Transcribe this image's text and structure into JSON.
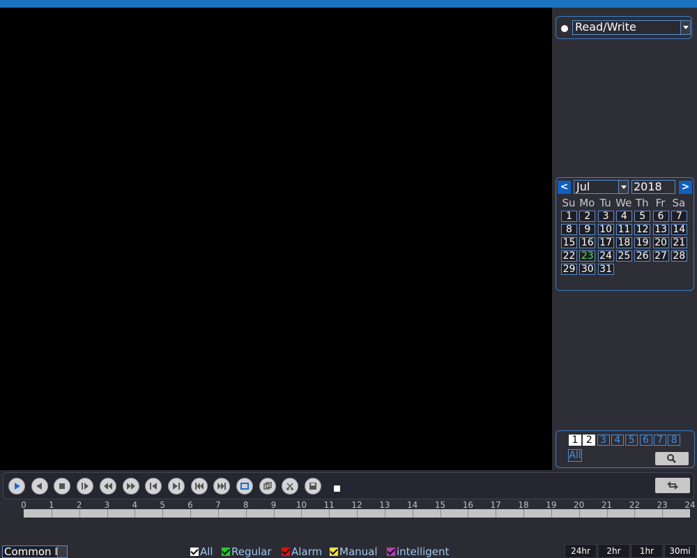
{
  "mode": {
    "selected": "Read/Write"
  },
  "calendar": {
    "month": "Jul",
    "year": "2018",
    "prev_label": "<",
    "next_label": ">",
    "weekdays": [
      "Su",
      "Mo",
      "Tu",
      "We",
      "Th",
      "Fr",
      "Sa"
    ],
    "days": [
      [
        "1",
        "2",
        "3",
        "4",
        "5",
        "6",
        "7"
      ],
      [
        "8",
        "9",
        "10",
        "11",
        "12",
        "13",
        "14"
      ],
      [
        "15",
        "16",
        "17",
        "18",
        "19",
        "20",
        "21"
      ],
      [
        "22",
        "23",
        "24",
        "25",
        "26",
        "27",
        "28"
      ],
      [
        "29",
        "30",
        "31"
      ]
    ],
    "highlighted_day": "23",
    "highlight_color": "#55e055"
  },
  "channels": {
    "items": [
      "1",
      "2",
      "3",
      "4",
      "5",
      "6",
      "7",
      "8"
    ],
    "selected": [
      "1",
      "2"
    ],
    "all_label": "All"
  },
  "controls": {
    "buttons": [
      "play-icon",
      "reverse-play-icon",
      "stop-icon",
      "slow-play-icon",
      "fast-backward-icon",
      "fast-forward-icon",
      "previous-frame-icon",
      "next-frame-icon",
      "previous-file-icon",
      "next-file-icon",
      "loop-icon",
      "fullscreen-icon",
      "clip-icon",
      "save-icon"
    ],
    "sync_icon": "sync-icon",
    "search_icon": "search-icon"
  },
  "timeline": {
    "labels": [
      "0",
      "1",
      "2",
      "3",
      "4",
      "5",
      "6",
      "7",
      "8",
      "9",
      "10",
      "11",
      "12",
      "13",
      "14",
      "15",
      "16",
      "17",
      "18",
      "19",
      "20",
      "21",
      "22",
      "23",
      "24"
    ]
  },
  "bottom": {
    "common_select": "Common I",
    "filters": [
      {
        "label": "All",
        "color": "#ffffff"
      },
      {
        "label": "Regular",
        "color": "#22cc22"
      },
      {
        "label": "Alarm",
        "color": "#dd1111"
      },
      {
        "label": "Manual",
        "color": "#f0e040"
      },
      {
        "label": "intelligent",
        "color": "#b040b0"
      }
    ],
    "zoom": [
      "24hr",
      "2hr",
      "1hr",
      "30mi"
    ]
  },
  "colors": {
    "accent": "#1b73c0",
    "border": "#3c7fc4",
    "panel": "#2e2e37"
  }
}
